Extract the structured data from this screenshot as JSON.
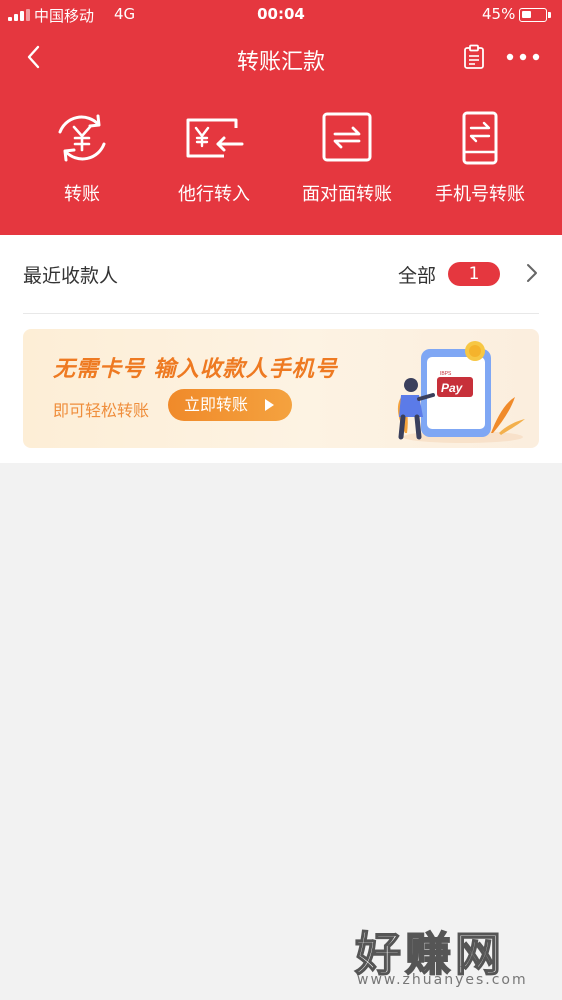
{
  "status_bar": {
    "carrier": "中国移动",
    "network": "4G",
    "time": "00:04",
    "battery_percent_text": "45%",
    "battery_level": 0.45
  },
  "nav": {
    "title": "转账汇款",
    "icons": [
      "back-arrow-icon",
      "clipboard-icon",
      "more-dots-icon"
    ]
  },
  "quick_actions": [
    {
      "label": "转账",
      "icon": "yuan-cycle-icon"
    },
    {
      "label": "他行转入",
      "icon": "card-transfer-in-icon"
    },
    {
      "label": "面对面转账",
      "icon": "face-to-face-icon"
    },
    {
      "label": "手机号转账",
      "icon": "phone-transfer-icon"
    }
  ],
  "recent": {
    "title": "最近收款人",
    "all_label": "全部",
    "count": "1"
  },
  "banner": {
    "headline": "无需卡号 输入收款人手机号",
    "subtext": "即可轻松转账",
    "button": "立即转账",
    "pay_badge": "Pay",
    "pay_small": "IBPS"
  },
  "watermark": {
    "title": "好赚网",
    "url": "www.zhuanyes.com"
  },
  "colors": {
    "brand_red": "#e5373f",
    "banner_orange": "#ee7a22",
    "background": "#f2f2f2"
  }
}
